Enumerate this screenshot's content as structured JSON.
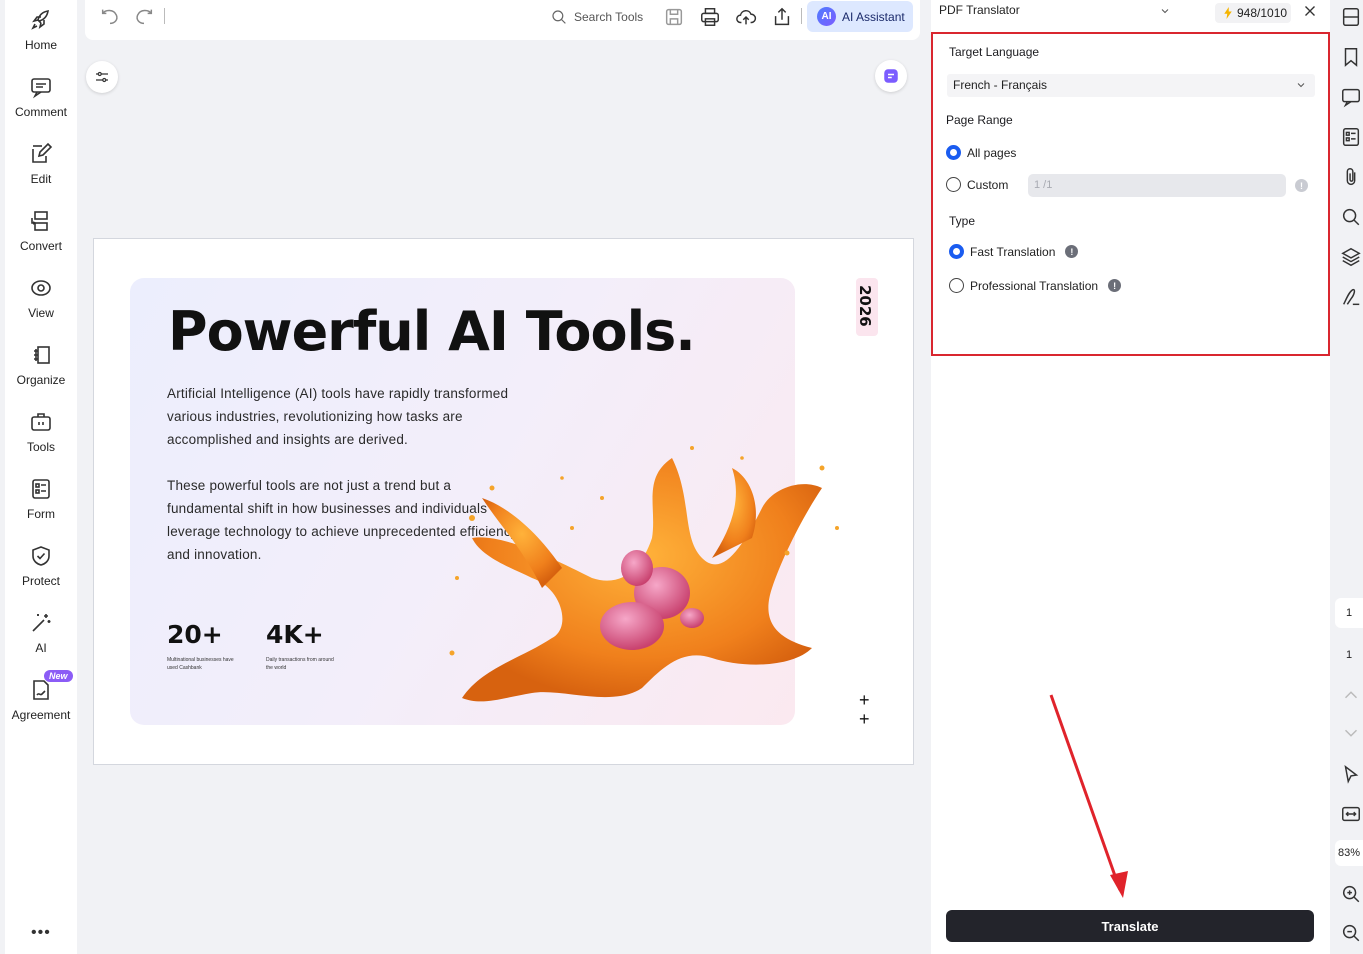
{
  "left_nav": {
    "items": [
      {
        "label": "Home",
        "icon": "rocket-icon"
      },
      {
        "label": "Comment",
        "icon": "comment-icon"
      },
      {
        "label": "Edit",
        "icon": "edit-icon"
      },
      {
        "label": "Convert",
        "icon": "convert-icon"
      },
      {
        "label": "View",
        "icon": "view-icon"
      },
      {
        "label": "Organize",
        "icon": "organize-icon"
      },
      {
        "label": "Tools",
        "icon": "toolbox-icon"
      },
      {
        "label": "Form",
        "icon": "form-icon"
      },
      {
        "label": "Protect",
        "icon": "shield-icon"
      },
      {
        "label": "AI",
        "icon": "magic-wand-icon"
      },
      {
        "label": "Agreement",
        "icon": "agreement-icon",
        "badge": "New"
      }
    ],
    "more": "•••"
  },
  "toolbar": {
    "search_label": "Search Tools",
    "ai_badge": "AI",
    "ai_label": "AI Assistant"
  },
  "document": {
    "title": "Powerful AI Tools.",
    "paragraph1": "Artificial Intelligence (AI) tools have rapidly transformed various industries, revolutionizing how tasks are accomplished and insights are derived.",
    "paragraph2": "These powerful tools are not just a trend but a fundamental shift in how businesses and individuals leverage technology to achieve unprecedented efficiency and innovation.",
    "stats": [
      {
        "value": "20+",
        "caption": "Multinational businesses have used Cashbank"
      },
      {
        "value": "4K+",
        "caption": "Daily transactions from around the world"
      }
    ],
    "year": "2026",
    "plus": "+"
  },
  "panel": {
    "tool_name": "PDF Translator",
    "credits": "948/1010",
    "target_language_label": "Target Language",
    "target_language_value": "French - Français",
    "page_range_label": "Page Range",
    "all_pages_label": "All pages",
    "custom_label": "Custom",
    "custom_range_value": "1 /1",
    "type_label": "Type",
    "fast_label": "Fast Translation",
    "professional_label": "Professional Translation",
    "translate_button": "Translate",
    "page_range_selected": "All pages",
    "type_selected": "Fast Translation"
  },
  "right_bar": {
    "current_page": "1",
    "total_pages": "1",
    "zoom": "83%"
  },
  "colors": {
    "accent_blue": "#1a5cf0",
    "highlight_red": "#d9262f",
    "button_dark": "#23242b",
    "ai_button_bg": "#dde8ff"
  }
}
